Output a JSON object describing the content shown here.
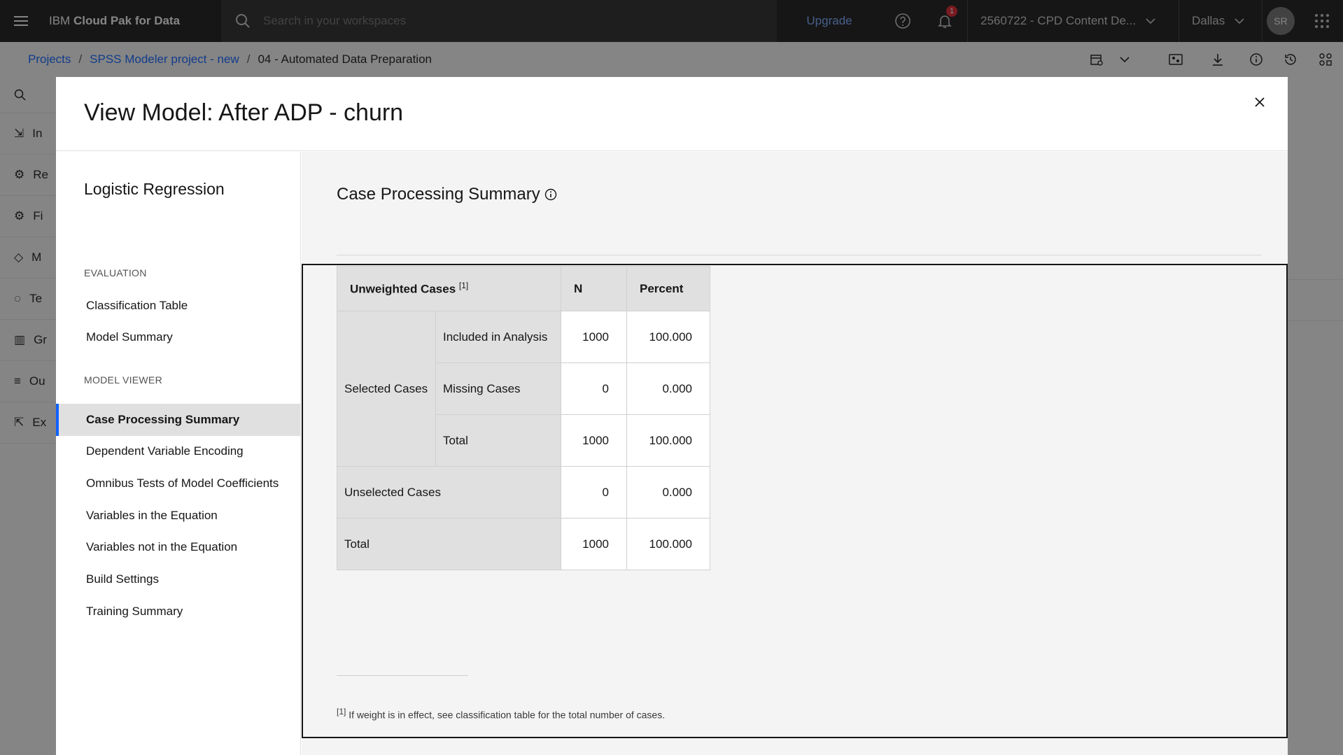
{
  "header": {
    "brand_prefix": "IBM",
    "brand_name": "Cloud Pak for Data",
    "search_placeholder": "Search in your workspaces",
    "upgrade_label": "Upgrade",
    "notification_count": "1",
    "account": "2560722 - CPD Content De...",
    "region": "Dallas",
    "avatar_initials": "SR"
  },
  "breadcrumb": {
    "items": [
      "Projects",
      "SPSS Modeler project - new"
    ],
    "current": "04 - Automated Data Preparation"
  },
  "rail": {
    "items": [
      "In",
      "Re",
      "Fi",
      "M",
      "Te",
      "Gr",
      "Ou",
      "Ex"
    ]
  },
  "modal": {
    "title": "View Model: After ADP - churn",
    "model_type": "Logistic Regression",
    "sections": {
      "evaluation": "EVALUATION",
      "model_viewer": "MODEL VIEWER"
    },
    "evaluation_items": [
      "Classification Table",
      "Model Summary"
    ],
    "viewer_items": [
      "Case Processing Summary",
      "Dependent Variable Encoding",
      "Omnibus Tests of Model Coefficients",
      "Variables in the Equation",
      "Variables not in the Equation",
      "Build Settings",
      "Training Summary"
    ],
    "active_item": "Case Processing Summary"
  },
  "content": {
    "title": "Case Processing Summary",
    "table": {
      "header": {
        "col1": "Unweighted Cases",
        "col1_note": "[1]",
        "n": "N",
        "percent": "Percent"
      },
      "selected_label": "Selected Cases",
      "rows": [
        {
          "label": "Included in Analysis",
          "n": "1000",
          "percent": "100.000"
        },
        {
          "label": "Missing Cases",
          "n": "0",
          "percent": "0.000"
        },
        {
          "label": "Total",
          "n": "1000",
          "percent": "100.000"
        }
      ],
      "unselected": {
        "label": "Unselected Cases",
        "n": "0",
        "percent": "0.000"
      },
      "total": {
        "label": "Total",
        "n": "1000",
        "percent": "100.000"
      }
    },
    "footnote_mark": "[1]",
    "footnote_text": "If weight is in effect, see classification table for the total number of cases."
  },
  "colors": {
    "header_bg": "#161616",
    "link": "#0f62fe",
    "upgrade": "#78a9ff",
    "badge": "#da1e28",
    "active_border": "#0f62fe"
  }
}
